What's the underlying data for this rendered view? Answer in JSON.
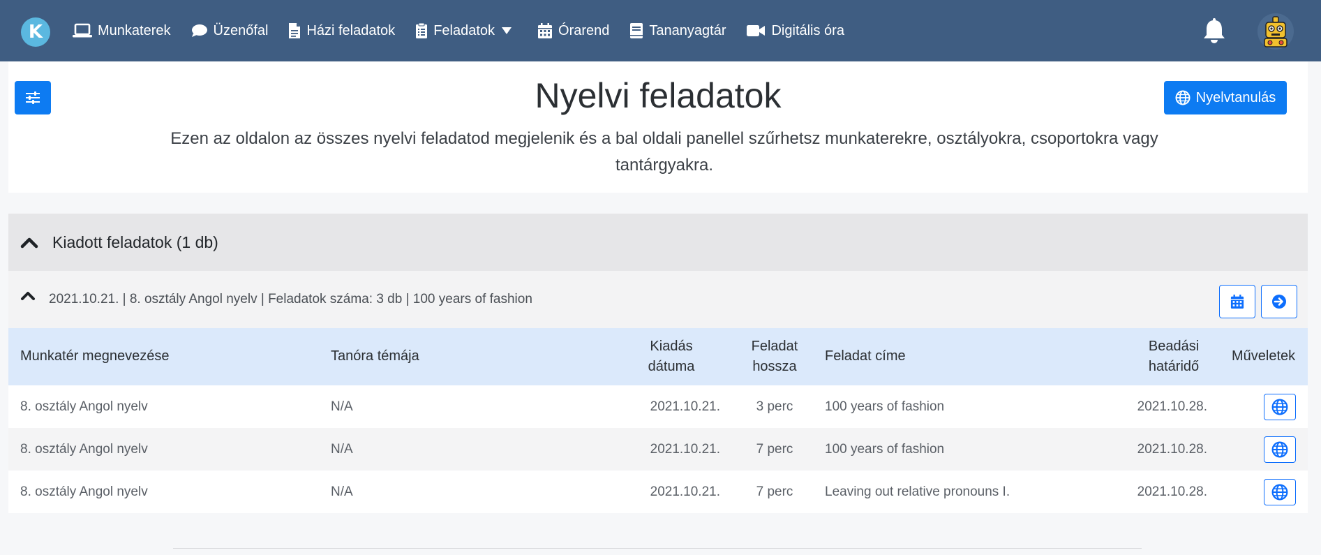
{
  "nav": {
    "logo_letter": "K",
    "items": [
      {
        "label": "Munkaterek",
        "icon": "laptop-icon"
      },
      {
        "label": "Üzenőfal",
        "icon": "chat-icon"
      },
      {
        "label": "Házi feladatok",
        "icon": "file-icon"
      },
      {
        "label": "Feladatok",
        "icon": "clipboard-icon"
      },
      {
        "label": "Órarend",
        "icon": "calendar-icon"
      },
      {
        "label": "Tananyagtár",
        "icon": "book-icon"
      },
      {
        "label": "Digitális óra",
        "icon": "video-icon"
      }
    ]
  },
  "header": {
    "title": "Nyelvi feladatok",
    "description": "Ezen az oldalon az összes nyelvi feladatod megjelenik és a bal oldali panellel szűrhetsz munkaterekre, osztályokra, csoportokra vagy tantárgyakra.",
    "language_button": "Nyelvtanulás"
  },
  "section": {
    "title": "Kiadott feladatok (1 db)"
  },
  "group": {
    "title": "2021.10.21. | 8. osztály Angol nyelv | Feladatok száma: 3 db | 100 years of fashion"
  },
  "table": {
    "headers": {
      "workspace": "Munkatér megnevezése",
      "topic": "Tanóra témája",
      "issued_1": "Kiadás",
      "issued_2": "dátuma",
      "length_1": "Feladat",
      "length_2": "hossza",
      "task_title": "Feladat címe",
      "deadline_1": "Beadási",
      "deadline_2": "határidő",
      "actions": "Műveletek"
    },
    "rows": [
      {
        "workspace": "8. osztály Angol nyelv",
        "topic": "N/A",
        "issued": "2021.10.21.",
        "length": "3 perc",
        "title": "100 years of fashion",
        "deadline": "2021.10.28."
      },
      {
        "workspace": "8. osztály Angol nyelv",
        "topic": "N/A",
        "issued": "2021.10.21.",
        "length": "7 perc",
        "title": "100 years of fashion",
        "deadline": "2021.10.28."
      },
      {
        "workspace": "8. osztály Angol nyelv",
        "topic": "N/A",
        "issued": "2021.10.21.",
        "length": "7 perc",
        "title": "Leaving out relative pronouns I.",
        "deadline": "2021.10.28."
      }
    ]
  },
  "colors": {
    "navbar": "#3f5d82",
    "primary": "#0d7bf2",
    "table_header": "#dbe9fb"
  }
}
